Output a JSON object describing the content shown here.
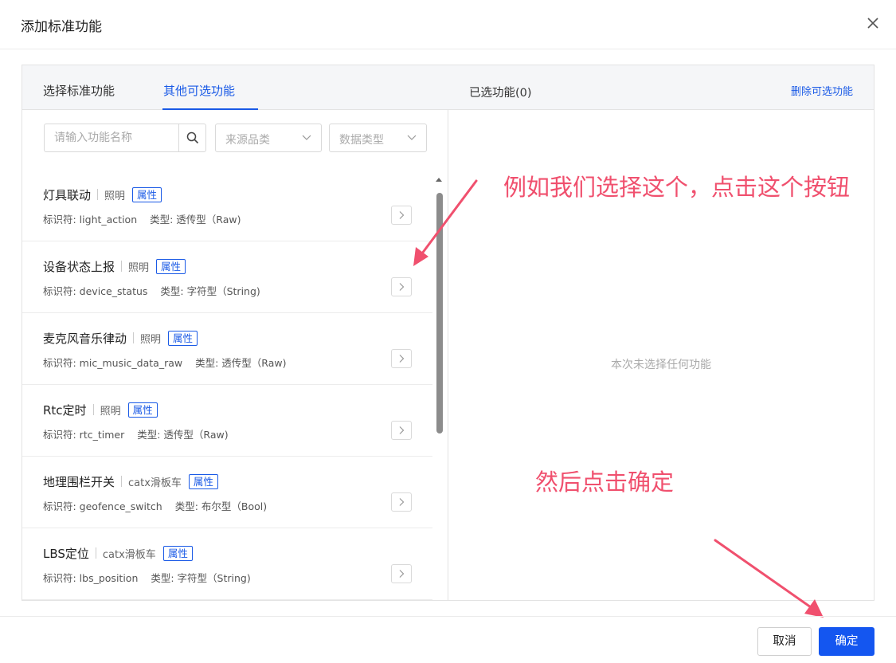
{
  "dialog": {
    "title": "添加标准功能"
  },
  "left": {
    "tabs": [
      {
        "label": "选择标准功能",
        "active": false
      },
      {
        "label": "其他可选功能",
        "active": true
      }
    ],
    "search_placeholder": "请输入功能名称",
    "filters": [
      {
        "label": "来源品类"
      },
      {
        "label": "数据类型"
      }
    ],
    "items": [
      {
        "name": "灯具联动",
        "category": "照明",
        "badge": "属性",
        "identifier": "标识符: light_action",
        "type": "类型: 透传型（Raw)"
      },
      {
        "name": "设备状态上报",
        "category": "照明",
        "badge": "属性",
        "identifier": "标识符: device_status",
        "type": "类型: 字符型（String)"
      },
      {
        "name": "麦克风音乐律动",
        "category": "照明",
        "badge": "属性",
        "identifier": "标识符: mic_music_data_raw",
        "type": "类型: 透传型（Raw)"
      },
      {
        "name": "Rtc定时",
        "category": "照明",
        "badge": "属性",
        "identifier": "标识符: rtc_timer",
        "type": "类型: 透传型（Raw)"
      },
      {
        "name": "地理围栏开关",
        "category": "catx滑板车",
        "badge": "属性",
        "identifier": "标识符: geofence_switch",
        "type": "类型: 布尔型（Bool)"
      },
      {
        "name": "LBS定位",
        "category": "catx滑板车",
        "badge": "属性",
        "identifier": "标识符: lbs_position",
        "type": "类型: 字符型（String)"
      }
    ]
  },
  "right": {
    "title": "已选功能(0)",
    "delete_link": "删除可选功能",
    "empty_text": "本次未选择任何功能"
  },
  "annotations": {
    "text1": "例如我们选择这个，点击这个按钮",
    "text2": "然后点击确定",
    "color": "#f0506e"
  },
  "footer": {
    "cancel": "取消",
    "confirm": "确定"
  },
  "colors": {
    "accent": "#1a5ae6",
    "primary_button": "#1456f0"
  }
}
